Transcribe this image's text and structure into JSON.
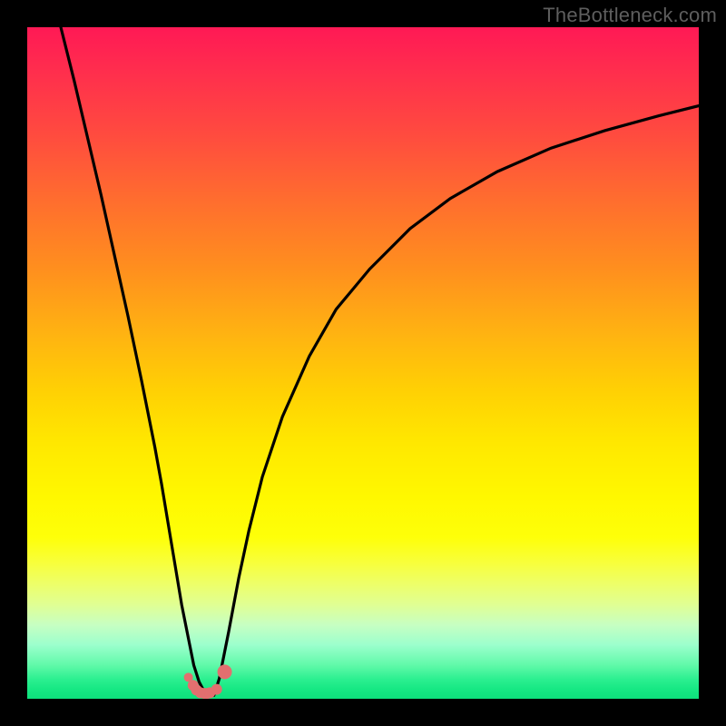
{
  "watermark": "TheBottleneck.com",
  "colors": {
    "frame_bg": "#000000",
    "gradient_top": "#ff1955",
    "gradient_mid": "#ffe800",
    "gradient_bottom": "#0ee07c",
    "curve_stroke": "#000000",
    "marker_fill": "#e26f6f",
    "marker_stroke": "#e26f6f"
  },
  "chart_data": {
    "type": "line",
    "title": "",
    "xlabel": "",
    "ylabel": "",
    "x_range": [
      0,
      100
    ],
    "y_range": [
      0,
      100
    ],
    "series": [
      {
        "name": "curve-left",
        "x": [
          5,
          7,
          9,
          11,
          13,
          15,
          17,
          19,
          20,
          21,
          22,
          23,
          24,
          24.8,
          25.6,
          26.4,
          26.8
        ],
        "y": [
          100,
          92,
          83.5,
          75,
          66,
          57,
          47.5,
          37.5,
          32,
          26,
          20,
          14,
          9,
          5,
          2.5,
          1,
          0.5
        ]
      },
      {
        "name": "curve-right",
        "x": [
          27.8,
          28.6,
          30,
          31.5,
          33,
          35,
          38,
          42,
          46,
          51,
          57,
          63,
          70,
          78,
          86,
          94,
          100
        ],
        "y": [
          0.5,
          3,
          10,
          18,
          25,
          33,
          42,
          51,
          58,
          64,
          70,
          74.5,
          78.5,
          82,
          84.6,
          86.8,
          88.3
        ]
      }
    ],
    "markers": {
      "name": "bottleneck-highlight",
      "x": [
        24.0,
        24.7,
        25.2,
        25.8,
        26.4,
        26.8,
        27.2,
        28.2,
        29.4
      ],
      "y": [
        3.2,
        2.0,
        1.3,
        0.9,
        0.8,
        0.8,
        0.9,
        1.4,
        4.0
      ],
      "size": [
        10,
        12,
        12,
        12,
        12,
        12,
        12,
        12,
        16
      ]
    }
  }
}
